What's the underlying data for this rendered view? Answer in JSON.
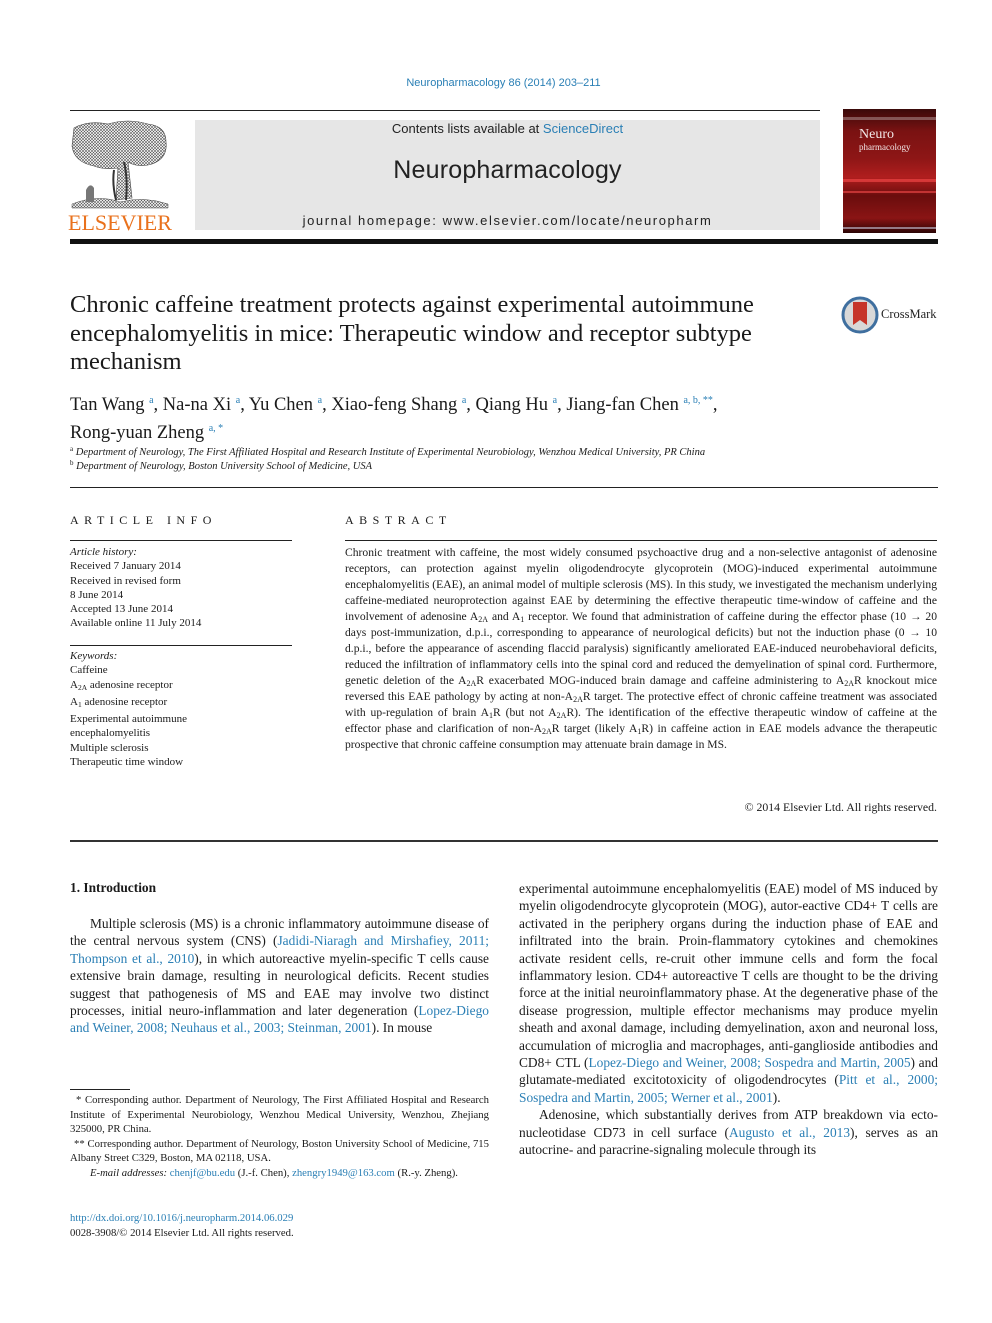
{
  "header": {
    "citation": "Neuropharmacology 86 (2014) 203–211",
    "contents_prefix": "Contents lists available at ",
    "contents_link": "ScienceDirect",
    "journal_title": "Neuropharmacology",
    "homepage": "journal homepage: www.elsevier.com/locate/neuropharm",
    "publisher_logo_text": "ELSEVIER",
    "cover_title_line1": "Neuro",
    "cover_title_line2": "pharmacology",
    "logo_icon": "elsevier-tree-icon",
    "cover_icon": "journal-cover-image"
  },
  "crossmark": {
    "label": "CrossMark",
    "icon": "crossmark-icon"
  },
  "article": {
    "title": "Chronic caffeine treatment protects against experimental autoimmune encephalomyelitis in mice: Therapeutic window and receptor subtype mechanism",
    "authors": [
      {
        "name": "Tan Wang",
        "sup": "a"
      },
      {
        "name": "Na-na Xi",
        "sup": "a"
      },
      {
        "name": "Yu Chen",
        "sup": "a"
      },
      {
        "name": "Xiao-feng Shang",
        "sup": "a"
      },
      {
        "name": "Qiang Hu",
        "sup": "a"
      },
      {
        "name": "Jiang-fan Chen",
        "sup": "a, b, **"
      },
      {
        "name": "Rong-yuan Zheng",
        "sup": "a, *"
      }
    ],
    "affiliations": [
      {
        "mark": "a",
        "text": "Department of Neurology, The First Affiliated Hospital and Research Institute of Experimental Neurobiology, Wenzhou Medical University, PR China"
      },
      {
        "mark": "b",
        "text": "Department of Neurology, Boston University School of Medicine, USA"
      }
    ]
  },
  "article_info": {
    "heading": "ARTICLE INFO",
    "history_label": "Article history:",
    "history": [
      "Received 7 January 2014",
      "Received in revised form",
      "8 June 2014",
      "Accepted 13 June 2014",
      "Available online 11 July 2014"
    ],
    "keywords_label": "Keywords:",
    "keywords": [
      {
        "text": "Caffeine"
      },
      {
        "pre": "A",
        "sub": "2A",
        "post": " adenosine receptor"
      },
      {
        "pre": "A",
        "sub": "1",
        "post": " adenosine receptor"
      },
      {
        "text": "Experimental autoimmune"
      },
      {
        "text": "encephalomyelitis"
      },
      {
        "text": "Multiple sclerosis"
      },
      {
        "text": "Therapeutic time window"
      }
    ]
  },
  "abstract": {
    "heading": "ABSTRACT",
    "segments": [
      "Chronic treatment with caffeine, the most widely consumed psychoactive drug and a non-selective antagonist of adenosine receptors, can protection against myelin oligodendrocyte glycoprotein (MOG)-induced experimental autoimmune encephalomyelitis (EAE), an animal model of multiple sclerosis (MS). In this study, we investigated the mechanism underlying caffeine-mediated neuroprotection against EAE by determining the effective therapeutic time-window of caffeine and the involvement of adenosine A",
      "2A",
      " and A",
      "1",
      " receptor. We found that administration of caffeine during the effector phase (10 → 20 days post-immunization, d.p.i., corresponding to appearance of neurological deficits) but not the induction phase (0 → 10 d.p.i., before the appearance of ascending flaccid paralysis) significantly ameliorated EAE-induced neurobehavioral deficits, reduced the infiltration of inflammatory cells into the spinal cord and reduced the demyelination of spinal cord. Furthermore, genetic deletion of the A",
      "2A",
      "R exacerbated MOG-induced brain damage and caffeine administering to A",
      "2A",
      "R knockout mice reversed this EAE pathology by acting at non-A",
      "2A",
      "R target. The protective effect of chronic caffeine treatment was associated with up-regulation of brain A",
      "1",
      "R (but not A",
      "2A",
      "R). The identification of the effective therapeutic window of caffeine at the effector phase and clarification of non-A",
      "2A",
      "R target (likely A",
      "1",
      "R) in caffeine action in EAE models advance the therapeutic prospective that chronic caffeine consumption may attenuate brain damage in MS."
    ],
    "copyright": "© 2014 Elsevier Ltd. All rights reserved."
  },
  "introduction": {
    "heading": "1.  Introduction",
    "col1": {
      "t1": "Multiple sclerosis (MS) is a chronic inflammatory autoimmune disease of the central nervous system (CNS) (",
      "l1": "Jadidi-Niaragh and Mirshafiey, 2011; Thompson et al., 2010",
      "t2": "), in which autoreactive myelin-specific T cells cause extensive brain damage, resulting in neurological deficits. Recent studies suggest that pathogenesis of MS and EAE may involve two distinct processes, initial neuro-inflammation and later degeneration (",
      "l2": "Lopez-Diego and Weiner, 2008; Neuhaus et al., 2003; Steinman, 2001",
      "t3": "). In mouse"
    },
    "col2": {
      "t1": "experimental autoimmune encephalomyelitis (EAE) model of MS induced by myelin oligodendrocyte glycoprotein (MOG), autor-eactive CD4+ T cells are activated in the periphery organs during the induction phase of EAE and infiltrated into the brain. Proin-flammatory cytokines and chemokines activate resident cells, re-cruit other immune cells and form the focal inflammatory lesion. CD4+ autoreactive T cells are thought to be the driving force at the initial neuroinflammatory phase. At the degenerative phase of the disease progression, multiple effector mechanisms may produce myelin sheath and axonal damage, including demyelination, axon and neuronal loss, accumulation of microglia and macrophages, anti-ganglioside antibodies and CD8+ CTL (",
      "l1": "Lopez-Diego and Weiner, 2008; Sospedra and Martin, 2005",
      "t2": ") and glutamate-mediated excitotoxicity of oligodendrocytes (",
      "l2": "Pitt et al., 2000; Sospedra and Martin, 2005; Werner et al., 2001",
      "t3": ").",
      "p2_t1": "Adenosine, which substantially derives from ATP breakdown via ecto-nucleotidase CD73 in cell surface (",
      "p2_l1": "Augusto et al., 2013",
      "p2_t2": "), serves as an autocrine- and paracrine-signaling molecule through its"
    }
  },
  "footnotes": {
    "star1": "* Corresponding author. Department of Neurology, The First Affiliated Hospital and Research Institute of Experimental Neurobiology, Wenzhou Medical University, Wenzhou, Zhejiang 325000, PR China.",
    "star2": "** Corresponding author. Department of Neurology, Boston University School of Medicine, 715 Albany Street C329, Boston, MA 02118, USA.",
    "email_label": "E-mail addresses:",
    "email1": "chenjf@bu.edu",
    "email1_who": " (J.-f. Chen), ",
    "email2": "zhengry1949@163.com",
    "email2_who": " (R.-y. Zheng).",
    "doi": "http://dx.doi.org/10.1016/j.neuropharm.2014.06.029",
    "issn": "0028-3908/© 2014 Elsevier Ltd. All rights reserved."
  }
}
